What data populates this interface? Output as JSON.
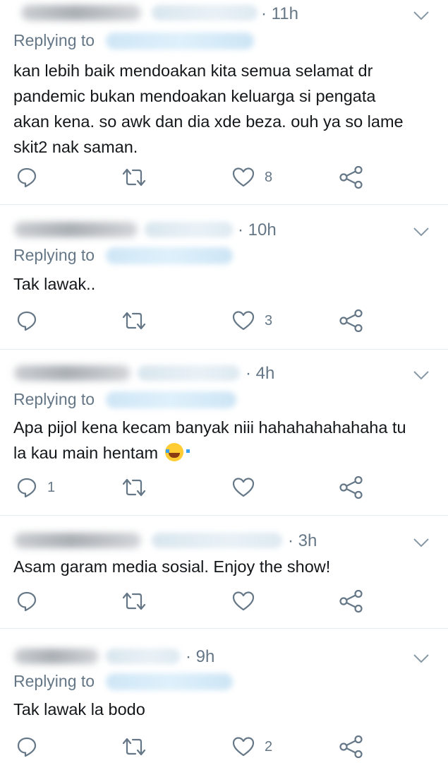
{
  "reply_label": "Replying to",
  "colors": {
    "icon": "#657786",
    "text": "#14171a",
    "divider": "#e6ecf0"
  },
  "icons": [
    "reply-icon",
    "retweet-icon",
    "like-icon",
    "share-icon",
    "chevron-down-icon"
  ],
  "tweets": [
    {
      "time": "· 11h",
      "replying": true,
      "lines": [
        "kan lebih baik mendoakan kita semua selamat dr",
        "pandemic bukan mendoakan keluarga si pengata",
        "akan kena. so awk dan dia xde beza. ouh ya so lame",
        "skit2 nak saman."
      ],
      "reply_count": "",
      "like_count": "8"
    },
    {
      "time": "· 10h",
      "replying": true,
      "lines": [
        "Tak lawak.."
      ],
      "reply_count": "",
      "like_count": "3"
    },
    {
      "time": "· 4h",
      "replying": true,
      "lines": [
        "Apa pijol kena kecam banyak niii hahahahahahaha tu",
        "la kau main hentam"
      ],
      "emoji": "face-with-tears-of-joy",
      "reply_count": "1",
      "like_count": ""
    },
    {
      "time": "· 3h",
      "replying": false,
      "lines": [
        "Asam garam media sosial. Enjoy the show!"
      ],
      "reply_count": "",
      "like_count": ""
    },
    {
      "time": "· 9h",
      "replying": true,
      "lines": [
        "Tak lawak la bodo"
      ],
      "reply_count": "",
      "like_count": "2"
    }
  ]
}
